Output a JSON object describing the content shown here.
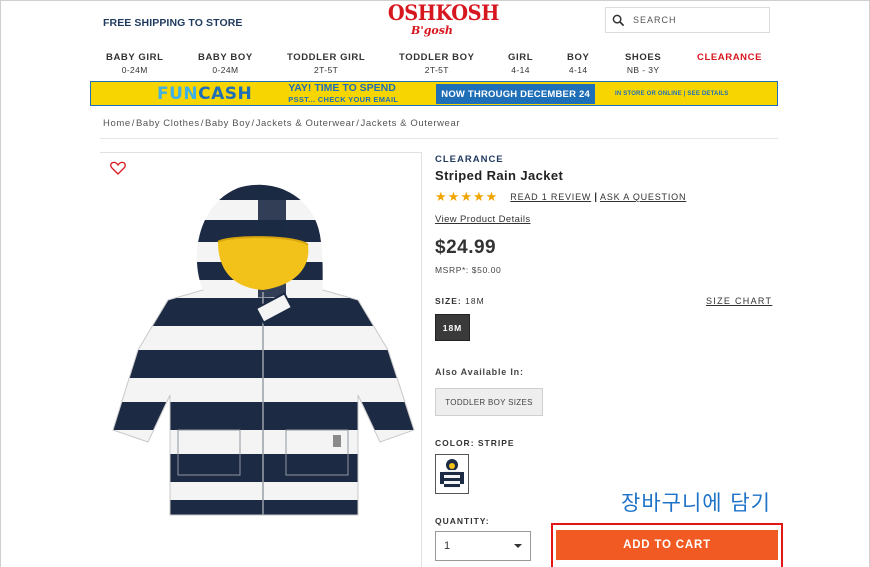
{
  "header": {
    "promo": "FREE SHIPPING TO STORE",
    "logo_main": "OSHKOSH",
    "logo_sub": "B'gosh",
    "search_placeholder": "SEARCH"
  },
  "nav": [
    {
      "label": "BABY GIRL",
      "sub": "0-24M"
    },
    {
      "label": "BABY BOY",
      "sub": "0-24M"
    },
    {
      "label": "TODDLER GIRL",
      "sub": "2T-5T"
    },
    {
      "label": "TODDLER BOY",
      "sub": "2T-5T"
    },
    {
      "label": "GIRL",
      "sub": "4-14"
    },
    {
      "label": "BOY",
      "sub": "4-14"
    },
    {
      "label": "SHOES",
      "sub": "NB - 3Y"
    },
    {
      "label": "CLEARANCE",
      "sub": ""
    }
  ],
  "banner": {
    "fun": "FUN",
    "cash": "CASH",
    "line1": "YAY! TIME TO SPEND",
    "line2": "PSST... CHECK YOUR EMAIL",
    "date": "NOW THROUGH DECEMBER 24",
    "store": "IN STORE OR ONLINE | SEE DETAILS"
  },
  "breadcrumb": [
    "Home",
    "Baby Clothes",
    "Baby Boy",
    "Jackets & Outerwear",
    "Jackets & Outerwear"
  ],
  "product": {
    "label": "CLEARANCE",
    "title": "Striped Rain Jacket",
    "rating": 5,
    "read_review": "READ 1 REVIEW",
    "ask_question": "ASK A QUESTION",
    "view_details": "View Product Details",
    "price": "$24.99",
    "msrp": "MSRP*: $50.00",
    "size_label": "SIZE:",
    "size_value": "18M",
    "size_chart": "SIZE CHART",
    "selected_size": "18M",
    "also_available": "Also Available In:",
    "toddler_sizes": "TODDLER BOY SIZES",
    "color_label": "COLOR: STRIPE",
    "quantity_label": "QUANTITY:",
    "quantity": "1",
    "add_to_cart": "ADD TO CART"
  },
  "annotation": {
    "korean_text": "장바구니에 담기",
    "highlight_color": "#e51616",
    "text_color": "#1e73c8"
  },
  "colors": {
    "brand_red": "#d7171f",
    "navy": "#1f3a5f",
    "cart_orange": "#f15a22",
    "banner_yellow": "#f7d500",
    "banner_blue": "#1f6fb8",
    "star": "#f0a500"
  }
}
